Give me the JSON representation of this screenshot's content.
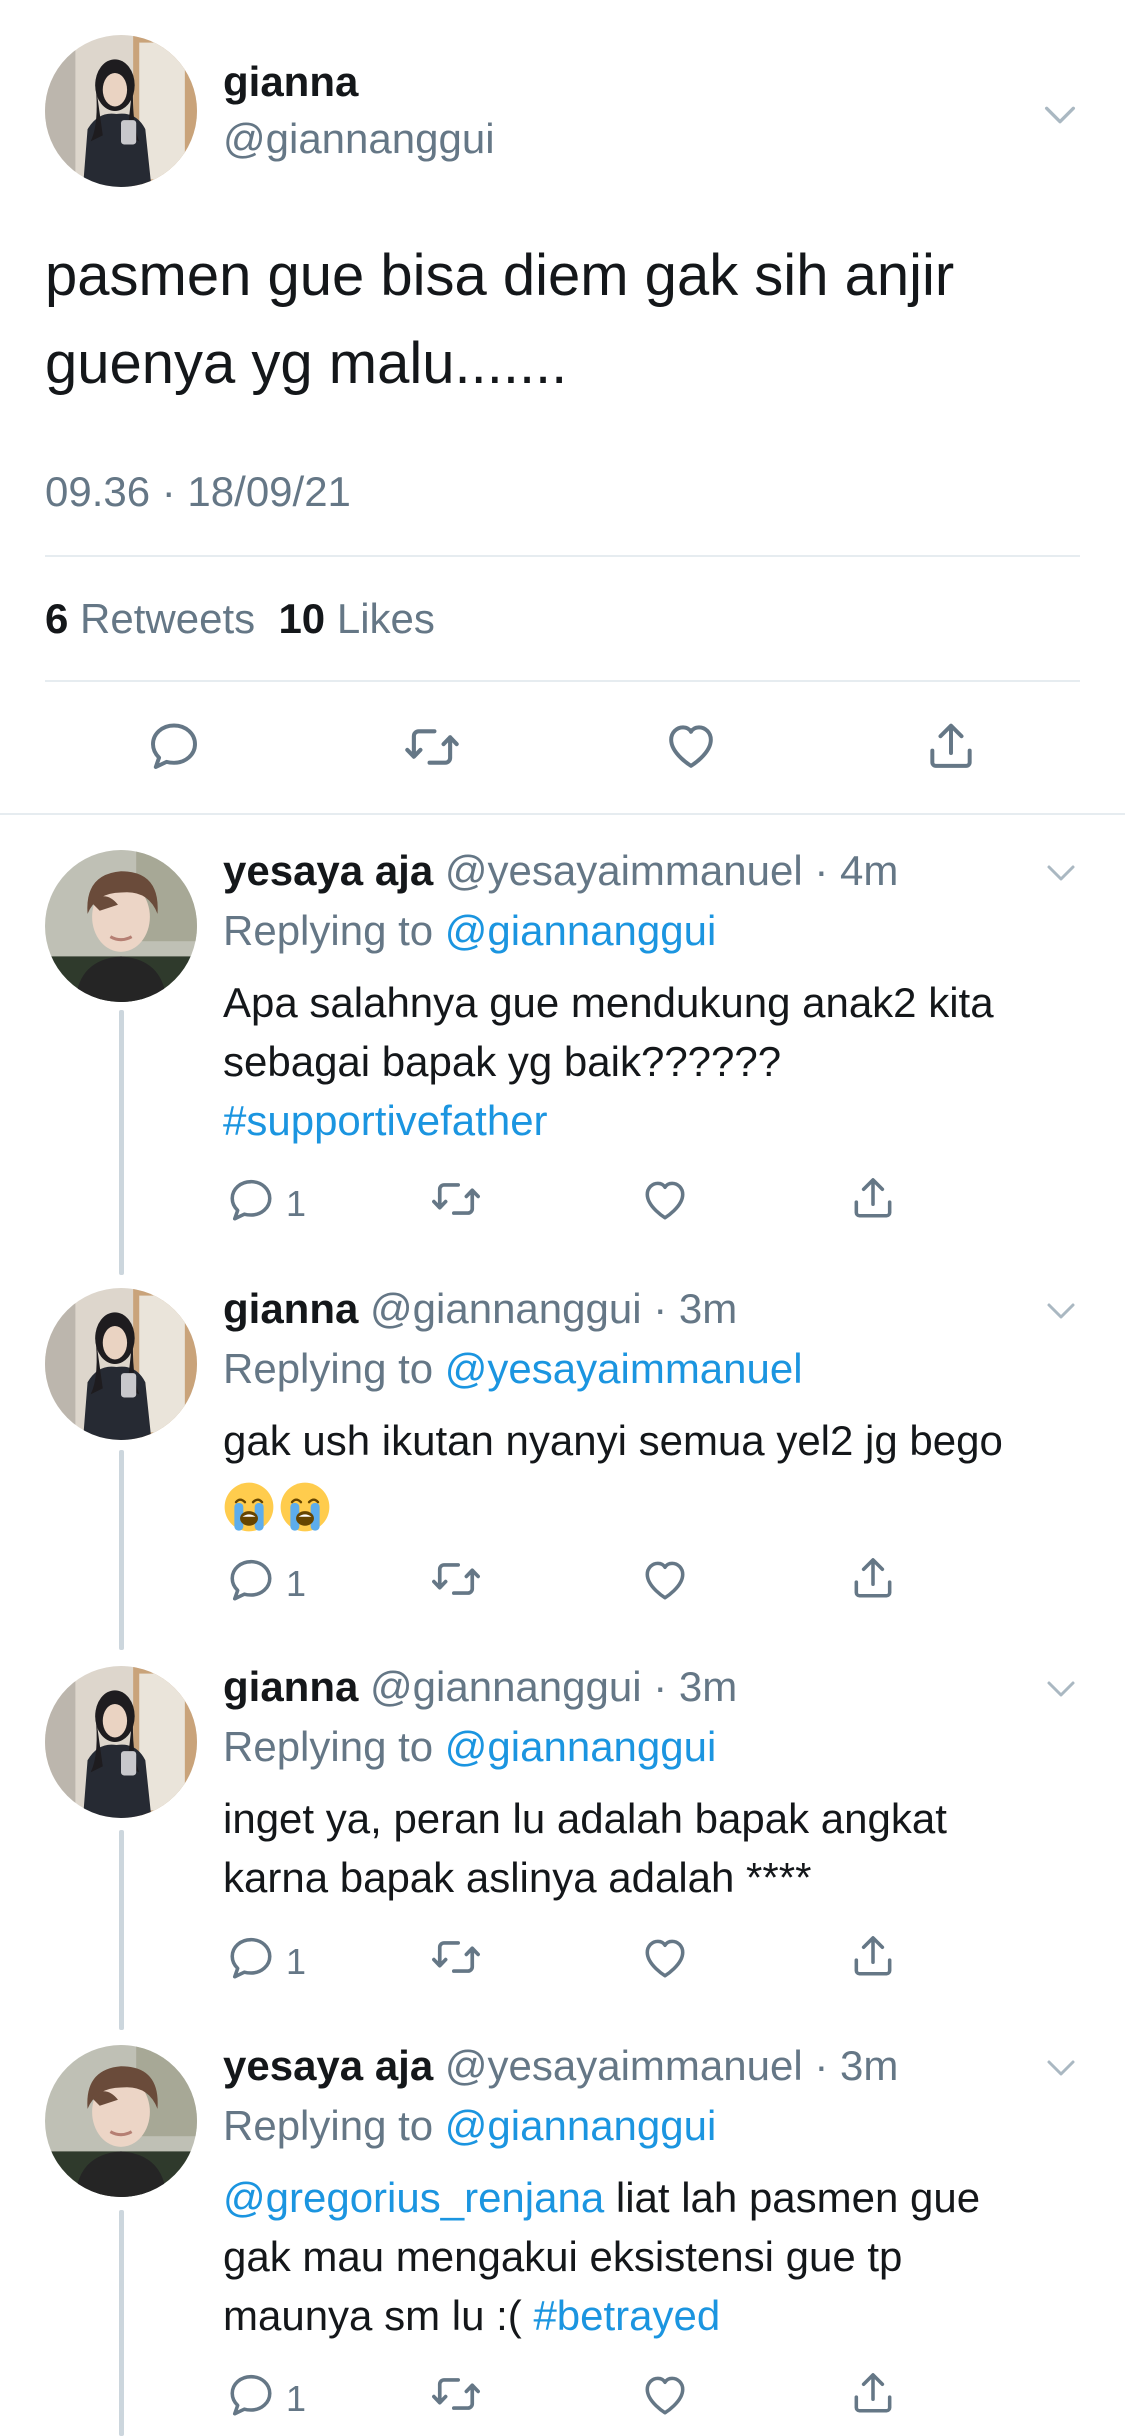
{
  "main_tweet": {
    "name": "gianna",
    "handle": "@giannanggui",
    "text_line1": "pasmen gue bisa diem gak sih anjir",
    "text_line2": "guenya yg malu.......",
    "timestamp": "09.36 · 18/09/21",
    "retweets_count": "6",
    "retweets_label": "Retweets",
    "likes_count": "10",
    "likes_label": "Likes"
  },
  "replies": [
    {
      "name": "yesaya aja",
      "meta": "@yesayaimmanuel · 4m",
      "replying_label": "Replying to",
      "replying_to": "@giannanggui",
      "line1": "Apa salahnya gue mendukung anak2 kita",
      "line2": "sebagai bapak yg baik??????",
      "hashtag": "#supportivefather",
      "reply_count": "1"
    },
    {
      "name": "gianna",
      "meta": "@giannanggui · 3m",
      "replying_label": "Replying to",
      "replying_to": "@yesayaimmanuel",
      "line1": "gak ush ikutan nyanyi semua yel2 jg bego",
      "emoji_name": "loudly-crying-face",
      "reply_count": "1"
    },
    {
      "name": "gianna",
      "meta": "@giannanggui · 3m",
      "replying_label": "Replying to",
      "replying_to": "@giannanggui",
      "line1": "inget ya, peran lu adalah bapak angkat",
      "line2": "karna bapak aslinya adalah ****",
      "reply_count": "1"
    },
    {
      "name": "yesaya aja",
      "meta": "@yesayaimmanuel · 3m",
      "replying_label": "Replying to",
      "replying_to": "@giannanggui",
      "mention": "@gregorius_renjana",
      "line1_rest": " liat lah pasmen gue",
      "line2": "gak mau mengakui eksistensi gue tp",
      "line3": "maunya sm lu :( ",
      "hashtag": "#betrayed",
      "reply_count": "1"
    }
  ],
  "icons": {
    "reply": "reply-icon",
    "retweet": "retweet-icon",
    "like": "heart-icon",
    "share": "share-icon",
    "more": "chevron-down-icon"
  },
  "colors": {
    "link": "#1b95e0",
    "secondary_text": "#657786",
    "divider": "#e6ecf0",
    "thread_line": "#ccd6dd"
  }
}
